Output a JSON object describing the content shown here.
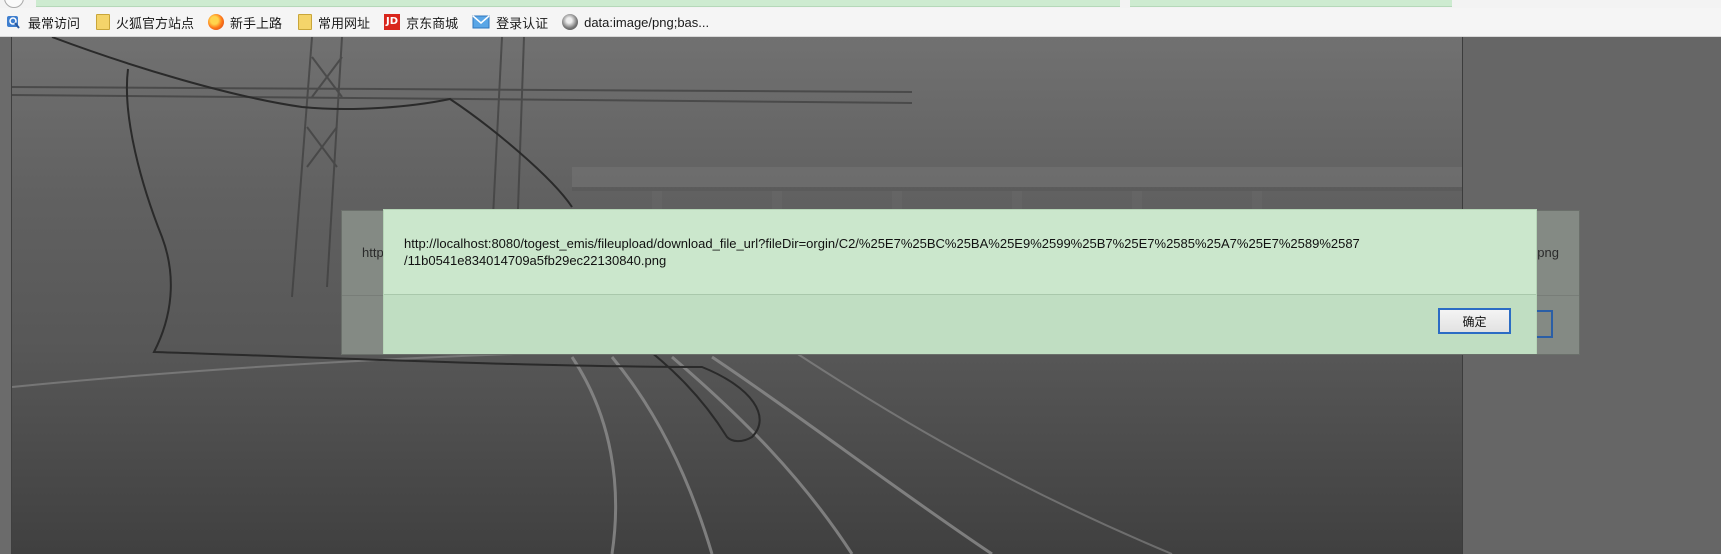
{
  "bookmarks": [
    {
      "label": "最常访问",
      "icon": "frequently-visited-icon"
    },
    {
      "label": "火狐官方站点",
      "icon": "folder-icon"
    },
    {
      "label": "新手上路",
      "icon": "firefox-icon"
    },
    {
      "label": "常用网址",
      "icon": "folder-icon"
    },
    {
      "label": "京东商城",
      "icon": "jd-icon"
    },
    {
      "label": "登录认证",
      "icon": "mail-icon"
    },
    {
      "label": "data:image/png;bas...",
      "icon": "globe-icon"
    }
  ],
  "jd_icon_text": "JD",
  "alert_shell": {
    "left_text": "http",
    "right_text": "png"
  },
  "dialog": {
    "message_line1": "http://localhost:8080/togest_emis/fileupload/download_file_url?fileDir=orgin/C2/%25E7%25BC%25BA%25E9%2599%25B7%25E7%2585%25A7%25E7%2589%2587",
    "message_line2": "/11b0541e834014709a5fb29ec22130840.png",
    "ok_label": "确定"
  },
  "colors": {
    "dialog_bg": "#cbe7cc",
    "dialog_footer": "#c0dec2",
    "button_border": "#2b6cc4",
    "page_bg": "#6b6b6b"
  }
}
